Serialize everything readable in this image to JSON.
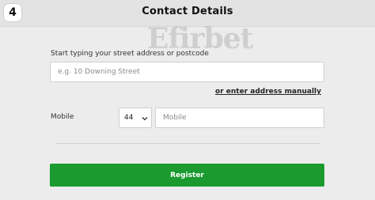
{
  "header": {
    "step_number": "4",
    "title": "Contact Details"
  },
  "watermark": {
    "text": "Efirbet"
  },
  "address": {
    "label": "Start typing your street address or postcode",
    "placeholder": "e.g. 10 Downing Street",
    "manual_link": "or enter address manually"
  },
  "mobile": {
    "label": "Mobile",
    "country_code": "44",
    "placeholder": "Mobile"
  },
  "register": {
    "label": "Register"
  },
  "colors": {
    "primary_button": "#1a9a2f",
    "background": "#ececec",
    "header": "#e3e3e3"
  }
}
